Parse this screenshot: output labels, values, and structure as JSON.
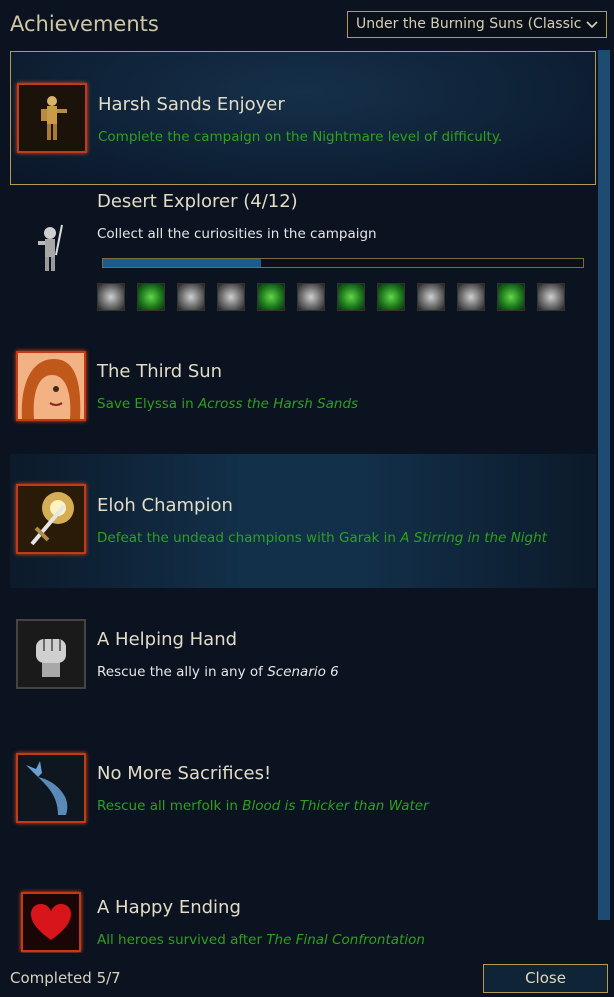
{
  "header": {
    "title": "Achievements",
    "campaign_select": "Under the Burning Suns (Classic ..."
  },
  "achievements": [
    {
      "name": "Harsh Sands Enjoyer",
      "description": "Complete the campaign on the Nightmare level of difficulty.",
      "icon": "desert-soldier-icon",
      "state": "unlocked"
    },
    {
      "name": "Desert Explorer (4/12)",
      "description": "Collect all the curiosities in the campaign",
      "icon": "skeleton-warrior-icon",
      "state": "locked",
      "progress": 0.33,
      "curiosities": [
        false,
        true,
        false,
        false,
        true,
        false,
        true,
        true,
        false,
        false,
        true,
        false
      ]
    },
    {
      "name": "The Third Sun",
      "description_prefix": "Save Elyssa in ",
      "description_italic": "Across the Harsh Sands",
      "icon": "elyssa-portrait-icon",
      "state": "unlocked"
    },
    {
      "name": "Eloh Champion",
      "description_prefix": "Defeat the undead champions with Garak in ",
      "description_italic": "A Stirring in the Night",
      "icon": "holy-sword-icon",
      "state": "unlocked"
    },
    {
      "name": "A Helping Hand",
      "description_prefix": "Rescue the ally in any of ",
      "description_italic": "Scenario 6",
      "icon": "fist-icon",
      "state": "locked"
    },
    {
      "name": "No More Sacrifices!",
      "description_prefix": "Rescue all merfolk in ",
      "description_italic": "Blood is Thicker than Water",
      "icon": "merfolk-tail-icon",
      "state": "unlocked"
    },
    {
      "name": "A Happy Ending",
      "description_prefix": "All heroes survived after ",
      "description_italic": "The Final Confrontation",
      "icon": "heart-icon",
      "state": "unlocked"
    }
  ],
  "footer": {
    "completed_text": "Completed 5/7",
    "close_label": "Close"
  },
  "colors": {
    "unlocked_text": "#2ea01e",
    "locked_text": "#e6e6e6",
    "frame_gold": "#b79a52",
    "frame_red": "#c23a16",
    "progress_fill": "#1b5c8c"
  }
}
